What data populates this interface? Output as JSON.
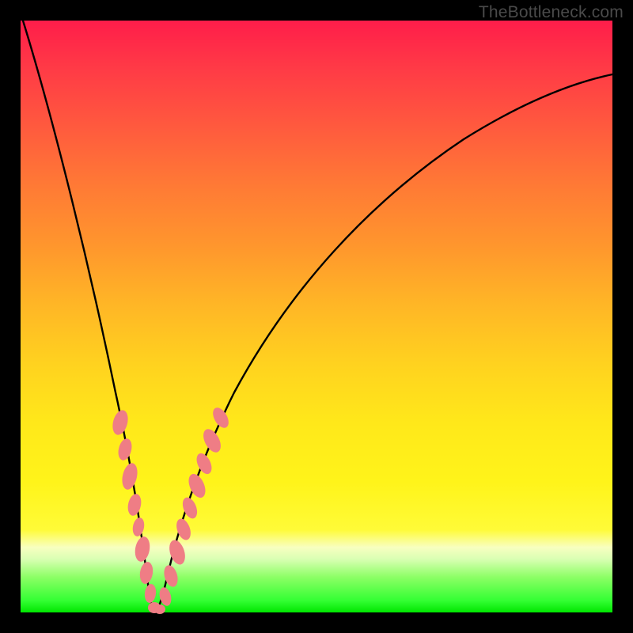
{
  "watermark": "TheBottleneck.com",
  "chart_data": {
    "type": "line",
    "title": "",
    "xlabel": "",
    "ylabel": "",
    "xlim": [
      0,
      100
    ],
    "ylim": [
      0,
      100
    ],
    "grid": false,
    "legend": false,
    "series": [
      {
        "name": "bottleneck-curve",
        "x": [
          0,
          3,
          6,
          9,
          12,
          14,
          16,
          18,
          19,
          20,
          21,
          22,
          23,
          24,
          25,
          27,
          30,
          34,
          40,
          48,
          58,
          70,
          84,
          100
        ],
        "y": [
          100,
          88,
          76,
          64,
          52,
          42,
          32,
          22,
          16,
          10,
          3,
          0,
          3,
          8,
          14,
          22,
          33,
          44,
          56,
          66,
          75,
          82,
          87,
          90
        ]
      }
    ],
    "markers": {
      "name": "highlighted-points",
      "color": "#ef7d85",
      "left_arm": {
        "x": [
          16.2,
          17.1,
          18.0,
          18.8,
          19.1,
          19.6,
          20.2,
          20.7,
          21.1
        ],
        "y": [
          30.5,
          24.5,
          19.0,
          13.0,
          10.5,
          7.0,
          4.0,
          1.8,
          0.6
        ]
      },
      "right_arm": {
        "x": [
          22.8,
          23.4,
          24.1,
          24.9,
          25.6,
          26.4,
          27.2,
          28.2,
          29.6,
          31.0
        ],
        "y": [
          2.2,
          5.0,
          8.5,
          12.2,
          15.6,
          19.2,
          22.5,
          26.3,
          30.8,
          34.8
        ]
      },
      "bottom": {
        "x": [
          21.4,
          21.8,
          22.2
        ],
        "y": [
          0.2,
          0.1,
          0.4
        ]
      }
    },
    "background_bands": [
      {
        "from_y": 100,
        "to_y": 14,
        "color_top": "#ff1d4a",
        "color_bottom": "#fff41a"
      },
      {
        "from_y": 14,
        "to_y": 0,
        "color_top": "#fffb37",
        "color_bottom": "#00e600"
      }
    ]
  }
}
